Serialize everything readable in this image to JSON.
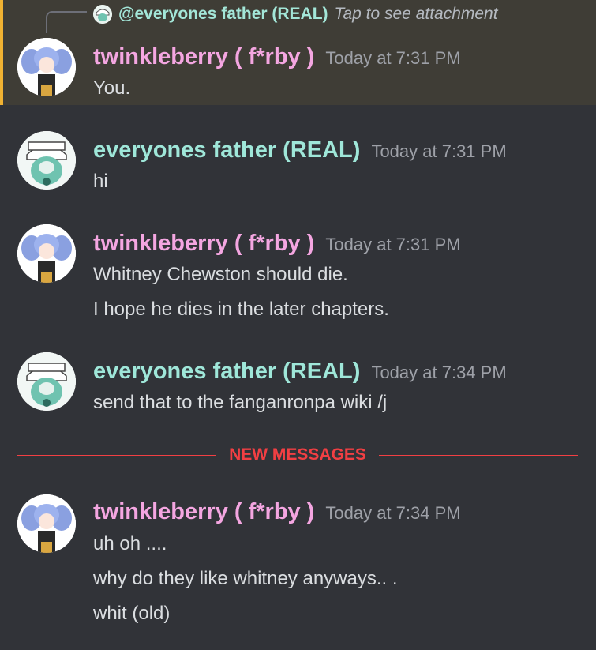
{
  "reply": {
    "mention": "@everyones father (REAL)",
    "preview": "Tap to see attachment"
  },
  "messages": [
    {
      "author": "twinkleberry ( f*rby )",
      "time": "Today at 7:31 PM",
      "lines": [
        "You."
      ]
    },
    {
      "author": "everyones father (REAL)",
      "time": "Today at 7:31 PM",
      "lines": [
        "hi"
      ]
    },
    {
      "author": "twinkleberry ( f*rby )",
      "time": "Today at 7:31 PM",
      "lines": [
        "Whitney Chewston should die.",
        "I hope he dies in the later chapters."
      ]
    },
    {
      "author": "everyones father (REAL)",
      "time": "Today at 7:34 PM",
      "lines": [
        "send that to the fanganronpa wiki  /j"
      ]
    },
    {
      "author": "twinkleberry ( f*rby )",
      "time": "Today at 7:34 PM",
      "lines": [
        "uh oh ....",
        "why do they like whitney anyways.. .",
        "whit (old)"
      ]
    }
  ],
  "divider": {
    "label": "NEW MESSAGES"
  },
  "colors": {
    "accent_highlight": "#f0b232",
    "pink_name": "#f4a6e1",
    "teal_name": "#9fe7d9",
    "new_messages_red": "#f23f43"
  }
}
